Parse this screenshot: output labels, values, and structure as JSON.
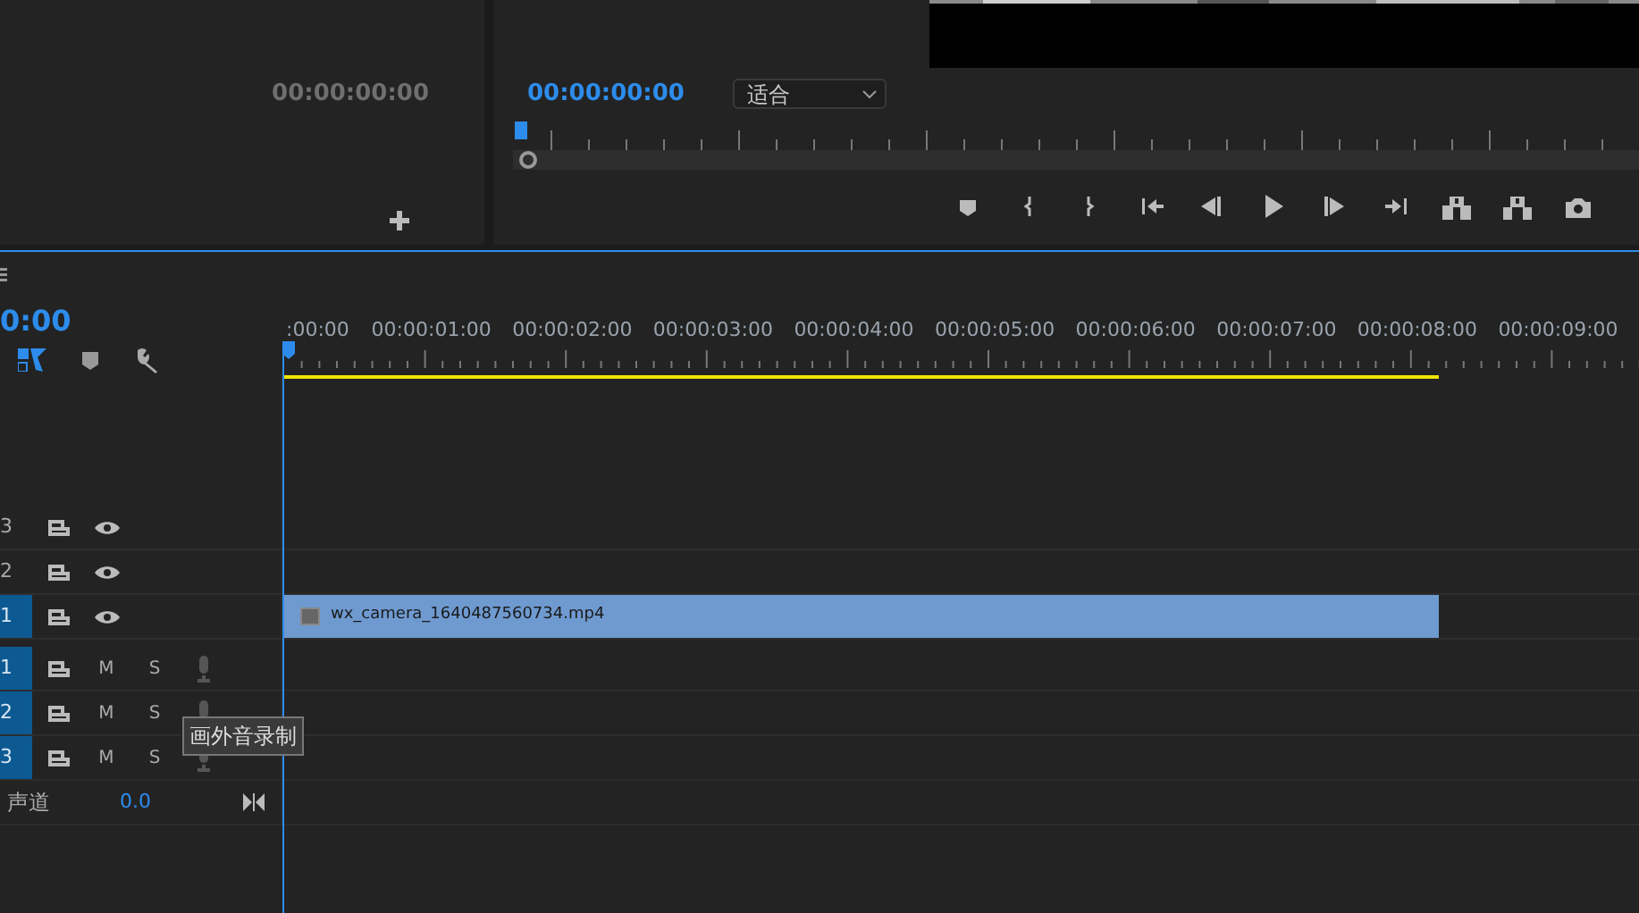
{
  "source_monitor": {
    "timecode": "00:00:00:00"
  },
  "program_monitor": {
    "timecode": "00:00:00:00",
    "zoom_dropdown": "适合"
  },
  "timeline": {
    "timecode": "0:00",
    "ruler_labels": [
      ":00:00",
      "00:00:01:00",
      "00:00:02:00",
      "00:00:03:00",
      "00:00:04:00",
      "00:00:05:00",
      "00:00:06:00",
      "00:00:07:00",
      "00:00:08:00",
      "00:00:09:00"
    ],
    "video_tracks": [
      {
        "label": "3",
        "targeted": false
      },
      {
        "label": "2",
        "targeted": false
      },
      {
        "label": "1",
        "targeted": true,
        "clip": "wx_camera_1640487560734.mp4"
      }
    ],
    "audio_tracks": [
      {
        "label": "1",
        "targeted": true,
        "mute": "M",
        "solo": "S"
      },
      {
        "label": "2",
        "targeted": true,
        "mute": "M",
        "solo": "S"
      },
      {
        "label": "3",
        "targeted": true,
        "mute": "M",
        "solo": "S"
      }
    ],
    "master": {
      "label": "声道",
      "value": "0.0"
    },
    "tooltip": "画外音录制"
  }
}
